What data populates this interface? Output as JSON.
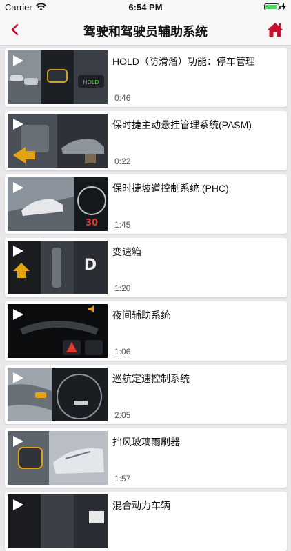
{
  "status_bar": {
    "carrier": "Carrier",
    "time": "6:54 PM",
    "battery_level": 0.9
  },
  "nav": {
    "title": "驾驶和驾驶员辅助系统",
    "back_icon": "chevron-left-icon",
    "home_icon": "home-icon",
    "accent_color": "#c8102e"
  },
  "videos": [
    {
      "title": "HOLD（防滑溜）功能：停车管理",
      "duration": "0:46"
    },
    {
      "title": "保时捷主动悬挂管理系统(PASM)",
      "duration": "0:22"
    },
    {
      "title": "保时捷坡道控制系统 (PHC)",
      "duration": "1:45"
    },
    {
      "title": "变速箱",
      "duration": "1:20"
    },
    {
      "title": "夜间辅助系统",
      "duration": "1:06"
    },
    {
      "title": "巡航定速控制系统",
      "duration": "2:05"
    },
    {
      "title": "挡风玻璃雨刷器",
      "duration": "1:57"
    },
    {
      "title": "混合动力车辆",
      "duration": ""
    }
  ],
  "thumb_text": {
    "hold": "HOLD",
    "speed": "30",
    "gear": "D"
  }
}
